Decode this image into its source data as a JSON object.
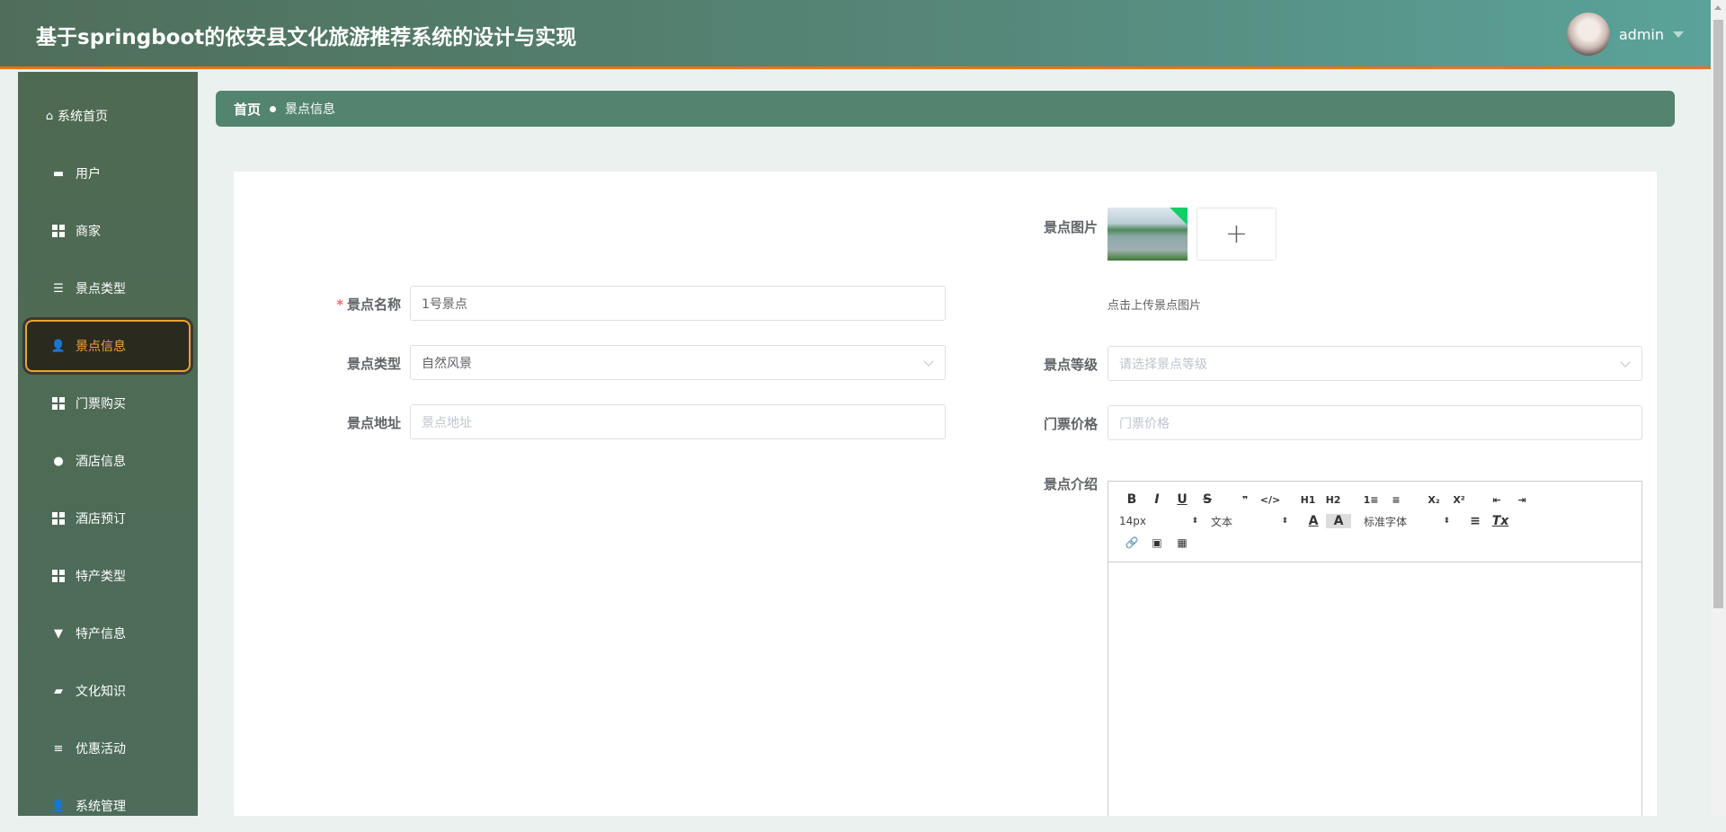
{
  "header": {
    "title": "基于springboot的依安县文化旅游推荐系统的设计与实现",
    "username": "admin"
  },
  "sidebar": {
    "items": [
      {
        "label": "系统首页",
        "icon": "home-icon"
      },
      {
        "label": "用户",
        "icon": "briefcase-icon"
      },
      {
        "label": "商家",
        "icon": "grid-icon"
      },
      {
        "label": "景点类型",
        "icon": "sliders-icon"
      },
      {
        "label": "景点信息",
        "icon": "user-icon",
        "active": true
      },
      {
        "label": "门票购买",
        "icon": "grid-icon"
      },
      {
        "label": "酒店信息",
        "icon": "bulb-icon"
      },
      {
        "label": "酒店预订",
        "icon": "grid-icon"
      },
      {
        "label": "特产类型",
        "icon": "grid-icon"
      },
      {
        "label": "特产信息",
        "icon": "stamp-icon"
      },
      {
        "label": "文化知识",
        "icon": "ticket-icon"
      },
      {
        "label": "优惠活动",
        "icon": "list-icon"
      },
      {
        "label": "系统管理",
        "icon": "user-icon"
      }
    ]
  },
  "breadcrumb": {
    "home": "首页",
    "current": "景点信息"
  },
  "form": {
    "name": {
      "label": "景点名称",
      "value": "1号景点",
      "required": "*"
    },
    "type": {
      "label": "景点类型",
      "value": "自然风景"
    },
    "address": {
      "label": "景点地址",
      "placeholder": "景点地址"
    },
    "image": {
      "label": "景点图片",
      "tip": "点击上传景点图片",
      "plus": "+"
    },
    "level": {
      "label": "景点等级",
      "placeholder": "请选择景点等级"
    },
    "price": {
      "label": "门票价格",
      "placeholder": "门票价格"
    },
    "intro": {
      "label": "景点介绍"
    }
  },
  "editor": {
    "buttons": [
      "B",
      "I",
      "U",
      "S",
      "❞",
      "</>",
      "H1",
      "H2",
      "1≡",
      "≡",
      "X₂",
      "X²",
      "⇤",
      "⇥"
    ],
    "font_size": "14px",
    "header": "文本",
    "font_family": "标准字体",
    "color": "A",
    "bg": "A",
    "align": "≡",
    "clean": "Tx",
    "row3": [
      "🔗",
      "▣",
      "▦"
    ]
  }
}
